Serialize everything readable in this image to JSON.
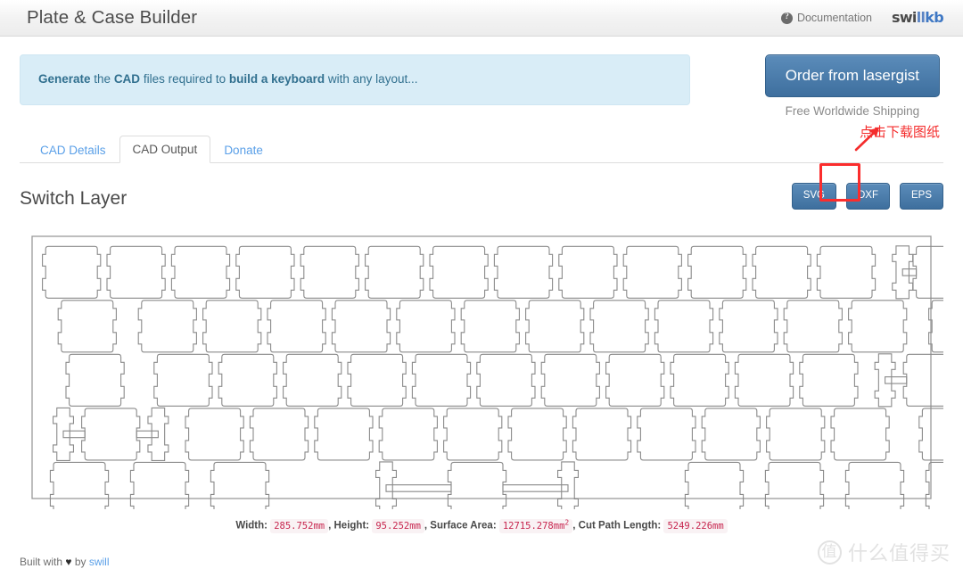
{
  "header": {
    "title": "Plate & Case Builder",
    "documentation_label": "Documentation",
    "doc_icon": "question-circle-icon",
    "logo": {
      "part1": "swi",
      "part2": "ll",
      "part3": "kb"
    }
  },
  "alert": {
    "b1": "Generate",
    "t1": " the ",
    "b2": "CAD",
    "t2": " files required to ",
    "b3": "build a keyboard",
    "t3": " with any layout..."
  },
  "order": {
    "button_label": "Order from lasergist",
    "subtext": "Free Worldwide Shipping"
  },
  "tabs": [
    {
      "label": "CAD Details",
      "active": false
    },
    {
      "label": "CAD Output",
      "active": true
    },
    {
      "label": "Donate",
      "active": false
    }
  ],
  "annotation": {
    "text": "点击下载图纸",
    "color": "#f42c2c",
    "arrow": "up-right-arrow-icon",
    "highlight_target": "DXF"
  },
  "output": {
    "section_title": "Switch Layer",
    "formats": [
      {
        "label": "SVG",
        "highlighted": false
      },
      {
        "label": "DXF",
        "highlighted": true
      },
      {
        "label": "EPS",
        "highlighted": false
      }
    ]
  },
  "stats": {
    "width_label": "Width:",
    "width_value": "285.752mm",
    "height_label": "Height:",
    "height_value": "95.252mm",
    "area_label": "Surface Area:",
    "area_value": "12715.278mm",
    "area_exp": "2",
    "cut_label": "Cut Path Length:",
    "cut_value": "5249.226mm",
    "comma": ","
  },
  "footer": {
    "built_pre": "Built with ",
    "heart": "♥",
    "built_mid": " by ",
    "author": "swill"
  },
  "watermark": {
    "mark": "值",
    "text": "什么值得买"
  },
  "plate": {
    "stroke_color": "#8a8a8a",
    "border_color": "#9a9a9a",
    "description": "60%-style keyboard switch plate cutout drawing, 5 rows",
    "rows": [
      {
        "keys": [
          1,
          1,
          1,
          1,
          1,
          1,
          1,
          1,
          1,
          1,
          1,
          1,
          1,
          2
        ],
        "stabilized": [
          13
        ]
      },
      {
        "keys": [
          1.5,
          1,
          1,
          1,
          1,
          1,
          1,
          1,
          1,
          1,
          1,
          1,
          1,
          1.5
        ],
        "stabilized": []
      },
      {
        "keys": [
          1.75,
          1,
          1,
          1,
          1,
          1,
          1,
          1,
          1,
          1,
          1,
          1,
          2.25
        ],
        "stabilized": [
          12
        ]
      },
      {
        "keys": [
          2.25,
          1,
          1,
          1,
          1,
          1,
          1,
          1,
          1,
          1,
          1,
          1,
          1.75
        ],
        "stabilized": [
          0
        ]
      },
      {
        "keys": [
          1.25,
          1.25,
          1.25,
          6.25,
          1.25,
          1.25,
          1.25,
          1.25
        ],
        "stabilized": [
          3
        ]
      }
    ]
  }
}
